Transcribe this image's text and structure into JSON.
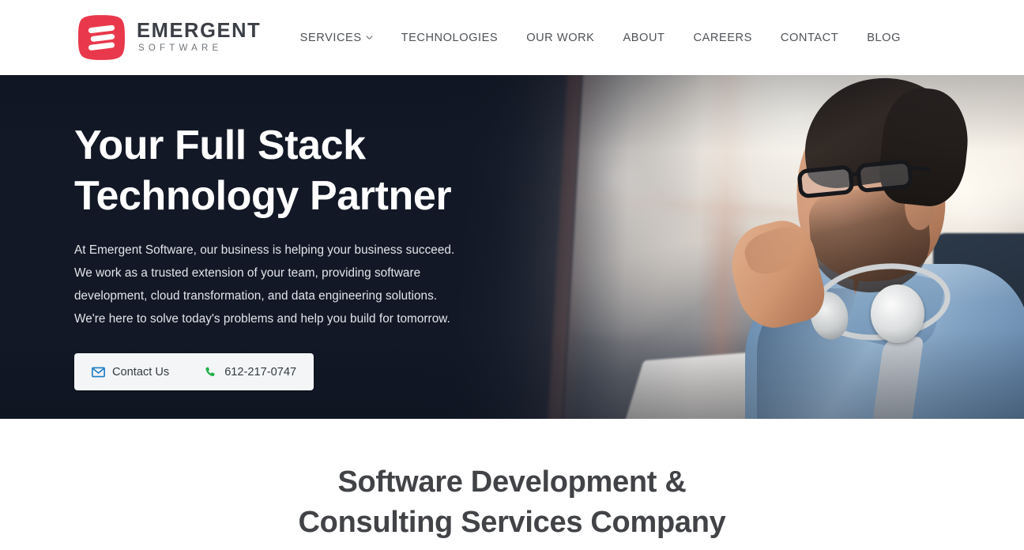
{
  "brand": {
    "logo_icon": "emergent-e-logo",
    "name_top": "EMERGENT",
    "name_sub": "SOFTWARE",
    "logo_color": "#e9384b",
    "wordmark_color": "#3b3f45"
  },
  "nav": {
    "items": [
      {
        "label": "SERVICES",
        "has_dropdown": true,
        "icon": "chevron-down-icon"
      },
      {
        "label": "TECHNOLOGIES",
        "has_dropdown": false
      },
      {
        "label": "OUR WORK",
        "has_dropdown": false
      },
      {
        "label": "ABOUT",
        "has_dropdown": false
      },
      {
        "label": "CAREERS",
        "has_dropdown": false
      },
      {
        "label": "CONTACT",
        "has_dropdown": false
      },
      {
        "label": "BLOG",
        "has_dropdown": false
      }
    ]
  },
  "hero": {
    "title_line1": "Your Full Stack",
    "title_line2": "Technology Partner",
    "paragraph_line1": "At Emergent Software, our business is helping your business succeed.",
    "paragraph_line2": "We work as a trusted extension of your team, providing software",
    "paragraph_line3": "development, cloud transformation, and data engineering solutions.",
    "paragraph_line4": "We're here to solve today's problems and help you build for tomorrow.",
    "background_color": "#121826",
    "image_description": "man with glasses and beard wearing denim shirt with headphones around neck at a desk",
    "cta": {
      "contact": {
        "label": "Contact Us",
        "icon": "envelope-icon",
        "icon_color": "#1a7dc4"
      },
      "phone": {
        "label": "612-217-0747",
        "icon": "phone-icon",
        "icon_color": "#22b14c"
      }
    }
  },
  "services_section": {
    "heading_line1": "Software Development &",
    "heading_line2": "Consulting Services Company",
    "heading_color": "#414346"
  }
}
